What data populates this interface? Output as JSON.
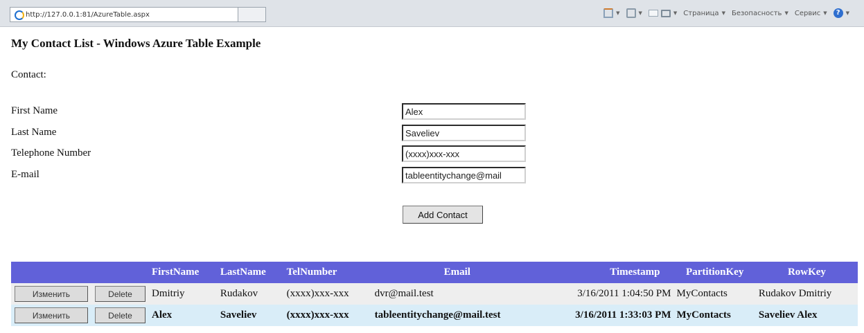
{
  "browser": {
    "tab_url": "http://127.0.0.1:81/AzureTable.aspx",
    "toolbar": {
      "page_menu": "Страница",
      "security_menu": "Безопасность",
      "service_menu": "Сервис",
      "help_glyph": "?"
    }
  },
  "page": {
    "title": "My Contact List - Windows Azure Table Example",
    "contact_label": "Contact:"
  },
  "form": {
    "first_name": {
      "label": "First Name",
      "value": "Alex"
    },
    "last_name": {
      "label": "Last Name",
      "value": "Saveliev"
    },
    "telephone": {
      "label": "Telephone Number",
      "value": "(xxxx)xxx-xxx"
    },
    "email": {
      "label": "E-mail",
      "value": "tableentitychange@mail"
    },
    "add_button": "Add Contact"
  },
  "grid": {
    "columns": [
      "FirstName",
      "LastName",
      "TelNumber",
      "Email",
      "Timestamp",
      "PartitionKey",
      "RowKey"
    ],
    "edit_label": "Изменить",
    "delete_label": "Delete",
    "rows": [
      {
        "first": "Dmitriy",
        "last": "Rudakov",
        "tel": "(xxxx)xxx-xxx",
        "email": "dvr@mail.test",
        "timestamp": "3/16/2011 1:04:50 PM",
        "partition": "MyContacts",
        "rowkey": "Rudakov Dmitriy",
        "selected": false
      },
      {
        "first": "Alex",
        "last": "Saveliev",
        "tel": "(xxxx)xxx-xxx",
        "email": "tableentitychange@mail.test",
        "timestamp": "3/16/2011 1:33:03 PM",
        "partition": "MyContacts",
        "rowkey": "Saveliev Alex",
        "selected": true
      }
    ]
  },
  "colors": {
    "header_bg": "#6161d9",
    "selected_row_bg": "#d9edf8",
    "row_bg": "#eeeeee"
  }
}
